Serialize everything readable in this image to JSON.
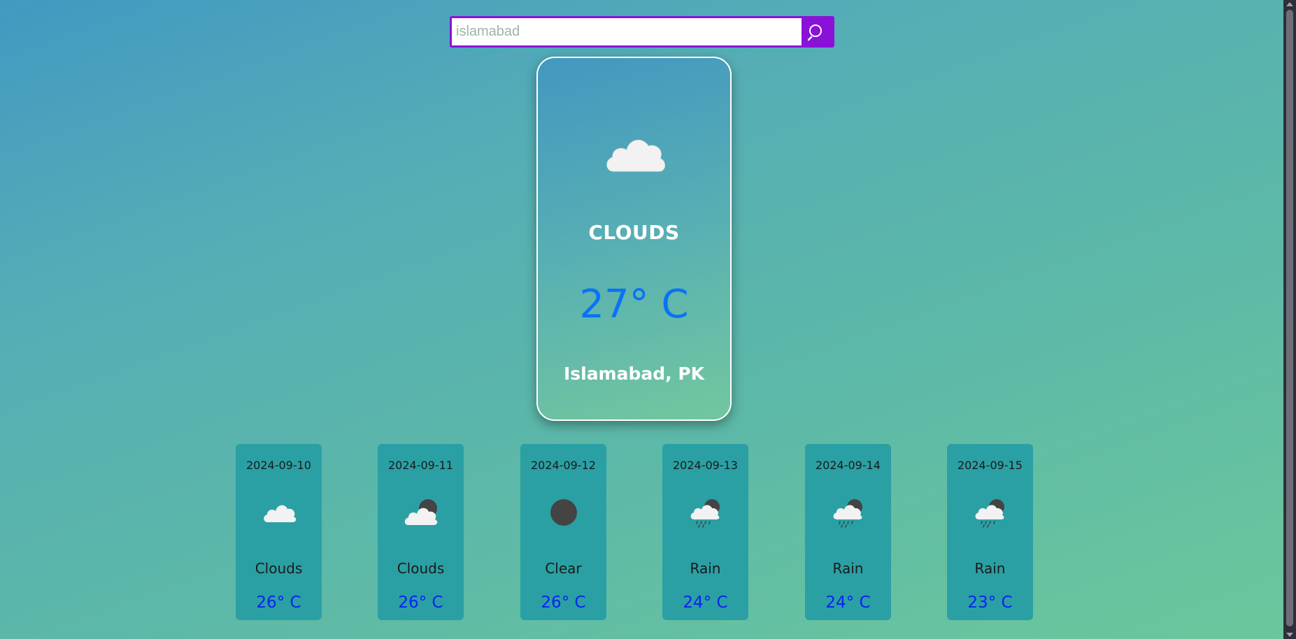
{
  "search": {
    "placeholder": "islamabad",
    "value": ""
  },
  "current": {
    "icon": "cloud-icon",
    "condition": "CLOUDS",
    "temperature": "27° C",
    "location": "Islamabad, PK"
  },
  "forecast": [
    {
      "date": "2024-09-10",
      "icon": "cloud-icon",
      "condition": "Clouds",
      "temperature": "26° C"
    },
    {
      "date": "2024-09-11",
      "icon": "cloud-moon-icon",
      "condition": "Clouds",
      "temperature": "26° C"
    },
    {
      "date": "2024-09-12",
      "icon": "moon-icon",
      "condition": "Clear",
      "temperature": "26° C"
    },
    {
      "date": "2024-09-13",
      "icon": "rain-moon-icon",
      "condition": "Rain",
      "temperature": "24° C"
    },
    {
      "date": "2024-09-14",
      "icon": "rain-moon-icon",
      "condition": "Rain",
      "temperature": "24° C"
    },
    {
      "date": "2024-09-15",
      "icon": "rain-moon-icon",
      "condition": "Rain",
      "temperature": "23° C"
    }
  ],
  "colors": {
    "accent": "#8a12d8",
    "main_temp": "#0a72f5",
    "forecast_temp": "#0a22f0",
    "forecast_card": "#2aa0a4"
  }
}
